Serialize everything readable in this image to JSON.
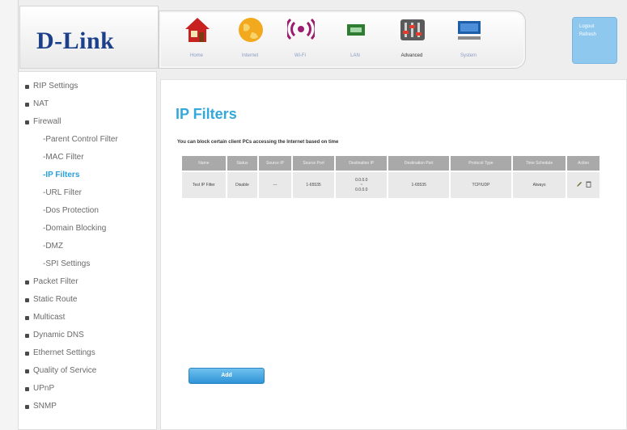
{
  "brand": {
    "logo_text": "D-Link"
  },
  "nav": [
    {
      "label": "Home",
      "icon": "home-icon"
    },
    {
      "label": "Internet",
      "icon": "globe-icon"
    },
    {
      "label": "Wi-Fi",
      "icon": "wifi-icon"
    },
    {
      "label": "LAN",
      "icon": "lan-icon"
    },
    {
      "label": "Advanced",
      "icon": "advanced-icon"
    },
    {
      "label": "System",
      "icon": "system-icon"
    }
  ],
  "account": {
    "logout": "Logout",
    "refresh": "Refresh"
  },
  "sidebar": {
    "items": [
      {
        "label": "RIP Settings"
      },
      {
        "label": "NAT"
      },
      {
        "label": "Firewall"
      },
      {
        "label": "-Parent Control Filter"
      },
      {
        "label": "-MAC Filter"
      },
      {
        "label": "-IP Filters"
      },
      {
        "label": "-URL Filter"
      },
      {
        "label": "-Dos Protection"
      },
      {
        "label": "-Domain Blocking"
      },
      {
        "label": "-DMZ"
      },
      {
        "label": "-SPI Settings"
      },
      {
        "label": "Packet Filter"
      },
      {
        "label": "Static Route"
      },
      {
        "label": "Multicast"
      },
      {
        "label": "Dynamic DNS"
      },
      {
        "label": "Ethernet Settings"
      },
      {
        "label": "Quality of Service"
      },
      {
        "label": "UPnP"
      },
      {
        "label": "SNMP"
      }
    ]
  },
  "main": {
    "title": "IP Filters",
    "description": "You can block certain client PCs accessing the Internet based on time",
    "table": {
      "headers": [
        "Name",
        "Status",
        "Source IP",
        "Source Port",
        "Destination IP",
        "Destination Port",
        "Protocol Type",
        "Time Schedule",
        "Action"
      ],
      "rows": [
        {
          "name": "Test IP Filter",
          "status": "Disable",
          "source_ip": "---",
          "source_port": "1-65535",
          "dest_ip_start": "0.0.0.0",
          "dest_ip_sep": "~",
          "dest_ip_end": "0.0.0.0",
          "dest_port": "1-65535",
          "protocol": "TCP/UDP",
          "schedule": "Always"
        }
      ]
    },
    "add_button": "Add"
  },
  "colors": {
    "title_blue": "#33a8da",
    "logo_blue": "#1b3f88",
    "button_blue": "#2f93d6",
    "header_gray": "#a9a9a9"
  }
}
